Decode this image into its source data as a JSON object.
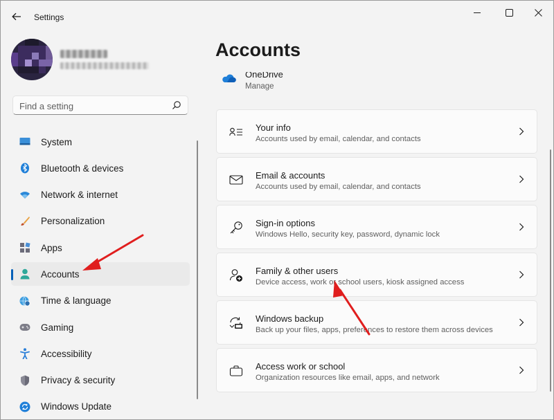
{
  "window": {
    "title": "Settings"
  },
  "search": {
    "placeholder": "Find a setting"
  },
  "sidebar": {
    "items": [
      {
        "label": "System",
        "icon": "monitor-icon"
      },
      {
        "label": "Bluetooth & devices",
        "icon": "bluetooth-icon"
      },
      {
        "label": "Network & internet",
        "icon": "wifi-icon"
      },
      {
        "label": "Personalization",
        "icon": "brush-icon"
      },
      {
        "label": "Apps",
        "icon": "apps-icon"
      },
      {
        "label": "Accounts",
        "icon": "person-icon",
        "selected": true
      },
      {
        "label": "Time & language",
        "icon": "globe-clock-icon"
      },
      {
        "label": "Gaming",
        "icon": "gamepad-icon"
      },
      {
        "label": "Accessibility",
        "icon": "accessibility-icon"
      },
      {
        "label": "Privacy & security",
        "icon": "shield-icon"
      },
      {
        "label": "Windows Update",
        "icon": "update-icon"
      }
    ]
  },
  "main": {
    "title": "Accounts",
    "onedrive": {
      "title": "OneDrive",
      "subtitle": "Manage"
    },
    "cards": [
      {
        "title": "Your info",
        "subtitle": "Accounts used by email, calendar, and contacts",
        "icon": "contact-card-icon"
      },
      {
        "title": "Email & accounts",
        "subtitle": "Accounts used by email, calendar, and contacts",
        "icon": "mail-icon"
      },
      {
        "title": "Sign-in options",
        "subtitle": "Windows Hello, security key, password, dynamic lock",
        "icon": "key-icon"
      },
      {
        "title": "Family & other users",
        "subtitle": "Device access, work or school users, kiosk assigned access",
        "icon": "person-add-icon"
      },
      {
        "title": "Windows backup",
        "subtitle": "Back up your files, apps, preferences to restore them across devices",
        "icon": "backup-icon"
      },
      {
        "title": "Access work or school",
        "subtitle": "Organization resources like email, apps, and network",
        "icon": "briefcase-icon"
      }
    ]
  },
  "colors": {
    "accent": "#005fb8",
    "annotation_arrow": "#e01e1e",
    "background": "#f3f3f3",
    "card": "#fbfbfb"
  }
}
